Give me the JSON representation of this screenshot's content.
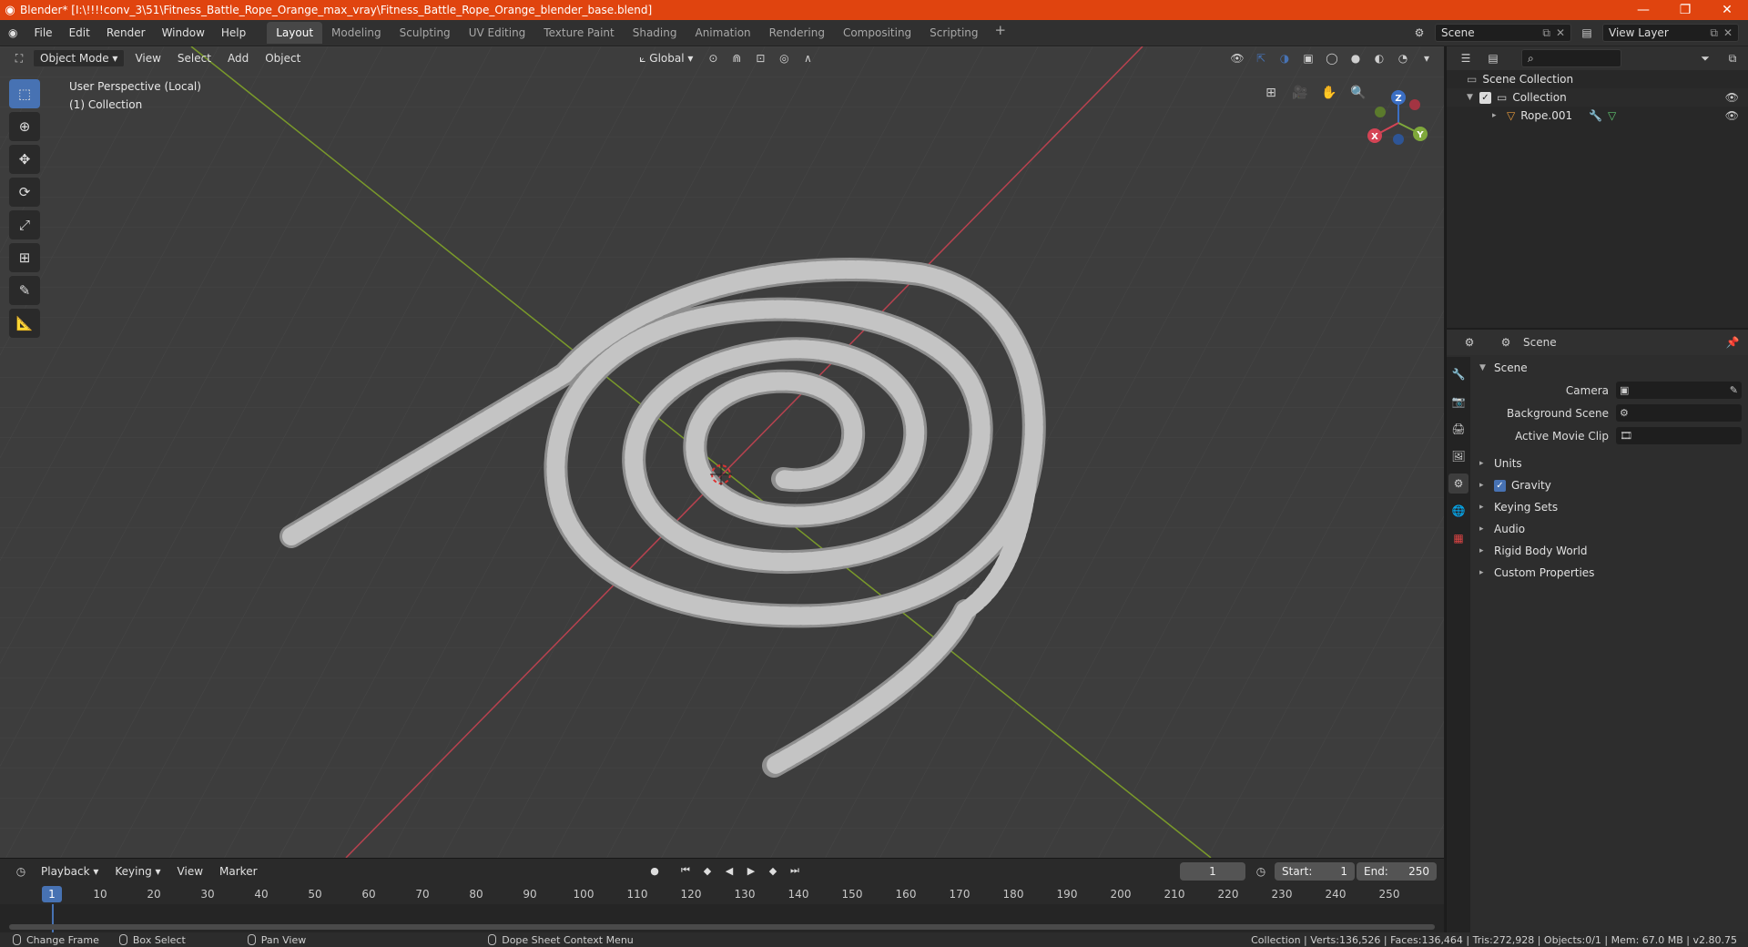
{
  "titlebar": {
    "title": "Blender* [I:\\!!!!conv_3\\51\\Fitness_Battle_Rope_Orange_max_vray\\Fitness_Battle_Rope_Orange_blender_base.blend]",
    "minimize": "—",
    "maximize": "❐",
    "close": "✕"
  },
  "menu": [
    "File",
    "Edit",
    "Render",
    "Window",
    "Help"
  ],
  "workspaces": [
    "Layout",
    "Modeling",
    "Sculpting",
    "UV Editing",
    "Texture Paint",
    "Shading",
    "Animation",
    "Rendering",
    "Compositing",
    "Scripting"
  ],
  "scene_field": "Scene",
  "view_layer_field": "View Layer",
  "viewport": {
    "mode": "Object Mode",
    "menus": [
      "View",
      "Select",
      "Add",
      "Object"
    ],
    "orientation": "Global",
    "info_line1": "User Perspective (Local)",
    "info_line2": "(1) Collection",
    "gizmo": {
      "x": "X",
      "y": "Y",
      "z": "Z"
    }
  },
  "timeline": {
    "menus": [
      "Playback",
      "Keying",
      "View",
      "Marker"
    ],
    "current_frame": "1",
    "start_label": "Start:",
    "start_value": "1",
    "end_label": "End:",
    "end_value": "250",
    "ticks": [
      "10",
      "20",
      "30",
      "40",
      "50",
      "60",
      "70",
      "80",
      "90",
      "100",
      "110",
      "120",
      "130",
      "140",
      "150",
      "160",
      "170",
      "180",
      "190",
      "200",
      "210",
      "220",
      "230",
      "240",
      "250"
    ]
  },
  "statusbar": {
    "items": [
      "Change Frame",
      "Box Select",
      "Pan View",
      "Dope Sheet Context Menu"
    ],
    "stats": "Collection | Verts:136,526 | Faces:136,464 | Tris:272,928 | Objects:0/1 | Mem: 67.0 MB | v2.80.75"
  },
  "outliner": {
    "scene_collection": "Scene Collection",
    "collection": "Collection",
    "object": "Rope.001"
  },
  "properties": {
    "context": "Scene",
    "panel": "Scene",
    "camera_label": "Camera",
    "background_scene_label": "Background Scene",
    "active_movie_clip_label": "Active Movie Clip",
    "sections": {
      "units": "Units",
      "gravity": "Gravity",
      "keying_sets": "Keying Sets",
      "audio": "Audio",
      "rigid_body_world": "Rigid Body World",
      "custom_properties": "Custom Properties"
    }
  },
  "colors": {
    "titlebar": "#e0440f",
    "accent": "#4772b3",
    "axis_x": "#b8424f",
    "axis_y": "#7a9a2a",
    "rope": "#b5b5b5"
  }
}
